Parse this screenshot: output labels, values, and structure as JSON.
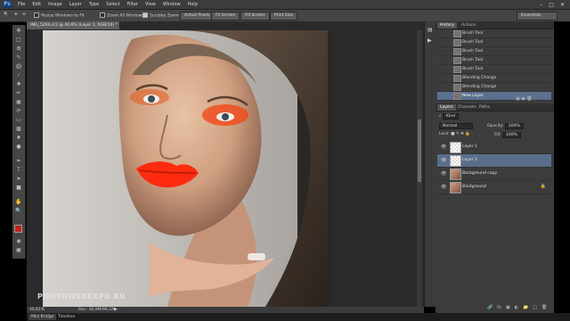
{
  "app": {
    "logo": "Ps"
  },
  "menu": [
    "File",
    "Edit",
    "Image",
    "Layer",
    "Type",
    "Select",
    "Filter",
    "View",
    "Window",
    "Help"
  ],
  "window_buttons": [
    "–",
    "□",
    "✕"
  ],
  "options": {
    "resize_windows": "Resize Windows to Fit",
    "zoom_all": "Zoom All Windows",
    "scrubby": "Scrubby Zoom",
    "actual_pixels": "Actual Pixels",
    "fit_screen": "Fit Screen",
    "fill_screen": "Fill Screen",
    "print_size": "Print Size",
    "workspace": "Essentials"
  },
  "document": {
    "tab_title": "IMG_5204.cr2 @ 40,6% (Layer 2, RGB/16) *",
    "zoom": "40,61%",
    "doc_info": "Doc: 36,9M/98,1M"
  },
  "watermark": "PHOTOWEBEXPO.RU",
  "bottom_tabs": [
    "Mini Bridge",
    "Timeline"
  ],
  "history_panel": {
    "tabs": [
      "History",
      "Actions"
    ],
    "items": [
      "Brush Tool",
      "Brush Tool",
      "Brush Tool",
      "Brush Tool",
      "Brush Tool",
      "Blending Change",
      "Blending Change",
      "New Layer"
    ]
  },
  "layers_panel": {
    "tabs": [
      "Layers",
      "Channels",
      "Paths"
    ],
    "kind": "Kind",
    "blend_mode": "Normal",
    "opacity_label": "Opacity:",
    "opacity_value": "100%",
    "lock_label": "Lock:",
    "fill_label": "Fill:",
    "fill_value": "100%",
    "layers": [
      {
        "name": "Layer 1",
        "type": "empty"
      },
      {
        "name": "Layer 2",
        "type": "empty"
      },
      {
        "name": "Background copy",
        "type": "photo"
      },
      {
        "name": "Background",
        "type": "photo"
      }
    ]
  },
  "colors": {
    "foreground": "#c0211b",
    "background": "#ffffff",
    "selection": "#5a6e8c"
  }
}
